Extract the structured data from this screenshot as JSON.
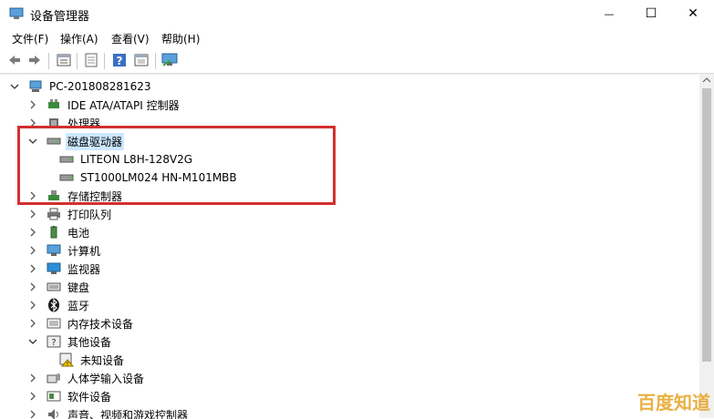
{
  "window": {
    "title": "设备管理器",
    "controls": {
      "minimize": "—",
      "maximize": "☐",
      "close": "✕"
    }
  },
  "menu": [
    "文件(F)",
    "操作(A)",
    "查看(V)",
    "帮助(H)"
  ],
  "toolbar": [
    "back-icon",
    "forward-icon",
    "properties-icon",
    "update-driver-icon",
    "help-icon",
    "scan-icon",
    "monitor-icon"
  ],
  "tree": {
    "root": "PC-201808281623",
    "items": [
      {
        "label": "IDE ATA/ATAPI 控制器",
        "expanded": false,
        "icon": "ide-controller-icon"
      },
      {
        "label": "处理器",
        "expanded": false,
        "icon": "processor-icon"
      },
      {
        "label": "磁盘驱动器",
        "expanded": true,
        "icon": "disk-drive-icon",
        "selected": true,
        "children": [
          {
            "label": "LITEON L8H-128V2G",
            "icon": "disk-icon"
          },
          {
            "label": "ST1000LM024 HN-M101MBB",
            "icon": "disk-icon"
          }
        ]
      },
      {
        "label": "存储控制器",
        "expanded": false,
        "icon": "storage-controller-icon"
      },
      {
        "label": "打印队列",
        "expanded": false,
        "icon": "printer-icon"
      },
      {
        "label": "电池",
        "expanded": false,
        "icon": "battery-icon"
      },
      {
        "label": "计算机",
        "expanded": false,
        "icon": "computer-icon"
      },
      {
        "label": "监视器",
        "expanded": false,
        "icon": "monitor-icon"
      },
      {
        "label": "键盘",
        "expanded": false,
        "icon": "keyboard-icon"
      },
      {
        "label": "蓝牙",
        "expanded": false,
        "icon": "bluetooth-icon"
      },
      {
        "label": "内存技术设备",
        "expanded": false,
        "icon": "memory-icon"
      },
      {
        "label": "其他设备",
        "expanded": true,
        "icon": "other-devices-icon",
        "children": [
          {
            "label": "未知设备",
            "icon": "unknown-device-warning-icon"
          }
        ]
      },
      {
        "label": "人体学输入设备",
        "expanded": false,
        "icon": "hid-icon"
      },
      {
        "label": "软件设备",
        "expanded": false,
        "icon": "software-device-icon"
      },
      {
        "label": "声音、视频和游戏控制器",
        "expanded": false,
        "icon": "sound-icon"
      }
    ]
  },
  "watermark": "百度知道",
  "colors": {
    "selection": "#cce8ff",
    "highlight_box": "#d32f2f",
    "watermark": "#e6a423"
  }
}
